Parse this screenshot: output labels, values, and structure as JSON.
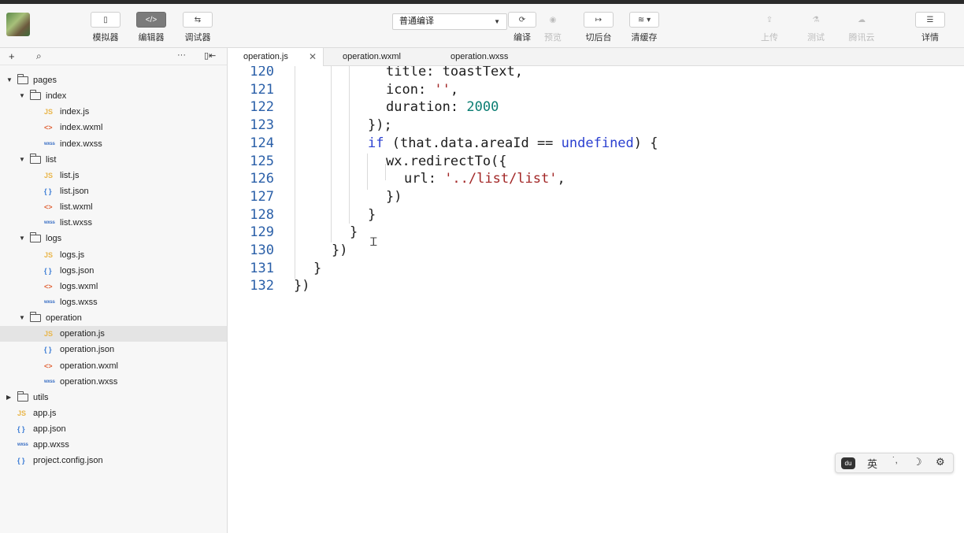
{
  "toolbar": {
    "simulator_label": "模拟器",
    "editor_label": "编辑器",
    "debugger_label": "调试器",
    "compile_mode": "普通编译",
    "compile_label": "编译",
    "preview_label": "预览",
    "background_label": "切后台",
    "clear_cache_label": "清缓存",
    "upload_label": "上传",
    "test_label": "测试",
    "cloud_label": "腾讯云",
    "details_label": "详情"
  },
  "sidebar": {
    "tree": [
      {
        "name": "pages",
        "type": "folder",
        "level": 0,
        "open": true
      },
      {
        "name": "index",
        "type": "folder",
        "level": 1,
        "open": true
      },
      {
        "name": "index.js",
        "type": "js",
        "level": 2
      },
      {
        "name": "index.wxml",
        "type": "wxml",
        "level": 2
      },
      {
        "name": "index.wxss",
        "type": "wxss",
        "level": 2
      },
      {
        "name": "list",
        "type": "folder",
        "level": 1,
        "open": true
      },
      {
        "name": "list.js",
        "type": "js",
        "level": 2
      },
      {
        "name": "list.json",
        "type": "json",
        "level": 2
      },
      {
        "name": "list.wxml",
        "type": "wxml",
        "level": 2
      },
      {
        "name": "list.wxss",
        "type": "wxss",
        "level": 2
      },
      {
        "name": "logs",
        "type": "folder",
        "level": 1,
        "open": true
      },
      {
        "name": "logs.js",
        "type": "js",
        "level": 2
      },
      {
        "name": "logs.json",
        "type": "json",
        "level": 2
      },
      {
        "name": "logs.wxml",
        "type": "wxml",
        "level": 2
      },
      {
        "name": "logs.wxss",
        "type": "wxss",
        "level": 2
      },
      {
        "name": "operation",
        "type": "folder",
        "level": 1,
        "open": true
      },
      {
        "name": "operation.js",
        "type": "js",
        "level": 2,
        "selected": true
      },
      {
        "name": "operation.json",
        "type": "json",
        "level": 2
      },
      {
        "name": "operation.wxml",
        "type": "wxml",
        "level": 2
      },
      {
        "name": "operation.wxss",
        "type": "wxss",
        "level": 2
      },
      {
        "name": "utils",
        "type": "folder",
        "level": 0,
        "open": false
      },
      {
        "name": "app.js",
        "type": "js",
        "level": 0
      },
      {
        "name": "app.json",
        "type": "json",
        "level": 0
      },
      {
        "name": "app.wxss",
        "type": "wxss",
        "level": 0
      },
      {
        "name": "project.config.json",
        "type": "json",
        "level": 0
      }
    ]
  },
  "tabs": [
    {
      "label": "operation.js",
      "active": true
    },
    {
      "label": "operation.wxml",
      "active": false
    },
    {
      "label": "operation.wxss",
      "active": false
    }
  ],
  "editor": {
    "lines": [
      {
        "n": "120",
        "text": "title: toastText,"
      },
      {
        "n": "121",
        "text": "icon: '',"
      },
      {
        "n": "122",
        "text": "duration: 2000"
      },
      {
        "n": "123",
        "text": "});"
      },
      {
        "n": "124",
        "text": "if (that.data.areaId == undefined) {"
      },
      {
        "n": "125",
        "text": "wx.redirectTo({"
      },
      {
        "n": "126",
        "text": "url: '../list/list',"
      },
      {
        "n": "127",
        "text": "})"
      },
      {
        "n": "128",
        "text": "}"
      },
      {
        "n": "129",
        "text": "}"
      },
      {
        "n": "130",
        "text": "})"
      },
      {
        "n": "131",
        "text": "}"
      },
      {
        "n": "132",
        "text": "})"
      }
    ]
  },
  "ime": {
    "logo": "du",
    "lang": "英",
    "punct": "˙,",
    "moon": "☽",
    "gear": "⚙"
  },
  "colors": {
    "keyword": "#2a3fd0",
    "string": "#a22626",
    "number": "#0a7d72",
    "line_number": "#2a5fa8"
  }
}
